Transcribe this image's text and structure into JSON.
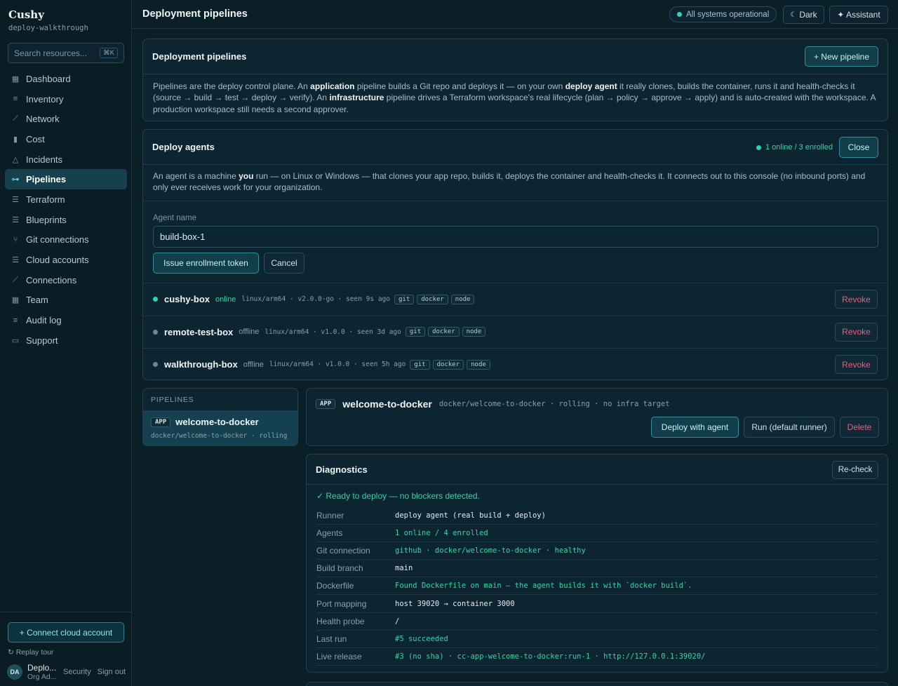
{
  "brand": {
    "name": "Cushy",
    "workspace": "deploy-walkthrough"
  },
  "search": {
    "placeholder": "Search resources...",
    "shortcut": "⌘K"
  },
  "nav": [
    {
      "label": "Dashboard",
      "icon": "grid-icon"
    },
    {
      "label": "Inventory",
      "icon": "list-icon"
    },
    {
      "label": "Network",
      "icon": "network-icon"
    },
    {
      "label": "Cost",
      "icon": "bar-chart-icon"
    },
    {
      "label": "Incidents",
      "icon": "warning-icon"
    },
    {
      "label": "Pipelines",
      "icon": "pipeline-icon",
      "active": true
    },
    {
      "label": "Terraform",
      "icon": "stack-icon"
    },
    {
      "label": "Blueprints",
      "icon": "stack-icon"
    },
    {
      "label": "Git connections",
      "icon": "git-branch-icon"
    },
    {
      "label": "Cloud accounts",
      "icon": "stack-icon"
    },
    {
      "label": "Connections",
      "icon": "link-icon"
    },
    {
      "label": "Team",
      "icon": "grid-icon"
    },
    {
      "label": "Audit log",
      "icon": "list-icon"
    },
    {
      "label": "Support",
      "icon": "chat-icon"
    }
  ],
  "sidebar_bottom": {
    "connect_label": "+ Connect cloud account",
    "replay_label": "Replay tour",
    "avatar_initials": "DA",
    "user_name": "Deplo...",
    "user_role": "Org Ad...",
    "security_label": "Security",
    "signout_label": "Sign out"
  },
  "topbar": {
    "title": "Deployment pipelines",
    "status": "All systems operational",
    "theme_label": "Dark",
    "assistant_label": "✦ Assistant"
  },
  "intro": {
    "title": "Deployment pipelines",
    "new_label": "+ New pipeline",
    "p_a": "Pipelines are the deploy control plane. An ",
    "p_b": "application",
    "p_c": " pipeline builds a Git repo and deploys it — on your own ",
    "p_d": "deploy agent",
    "p_e": " it really clones, builds the container, runs it and health-checks it (source → build → test → deploy → verify). An ",
    "p_f": "infrastructure",
    "p_g": " pipeline drives a Terraform workspace's real lifecycle (plan → policy → approve → apply) and is auto-created with the workspace. A production workspace still needs a second approver."
  },
  "agents": {
    "title": "Deploy agents",
    "summary": "1 online / 3 enrolled",
    "close_label": "Close",
    "p_a": "An agent is a machine ",
    "p_b": "you",
    "p_c": " run — on Linux or Windows — that clones your app repo, builds it, deploys the container and health-checks it. It connects out to this console (no inbound ports) and only ever receives work for your organization.",
    "name_label": "Agent name",
    "name_value": "build-box-1",
    "issue_label": "Issue enrollment token",
    "cancel_label": "Cancel",
    "revoke_label": "Revoke",
    "list": [
      {
        "name": "cushy-box",
        "status": "online",
        "meta": "linux/arm64 · v2.0.0-go · seen 9s ago",
        "tags": [
          "git",
          "docker",
          "node"
        ],
        "color": "#2ed5a8"
      },
      {
        "name": "remote-test-box",
        "status": "offline",
        "meta": "linux/arm64 · v1.0.0 · seen 3d ago",
        "tags": [
          "git",
          "docker",
          "node"
        ],
        "color": "#6f8790"
      },
      {
        "name": "walkthrough-box",
        "status": "offline",
        "meta": "linux/arm64 · v1.0.0 · seen 5h ago",
        "tags": [
          "git",
          "docker",
          "node"
        ],
        "color": "#6f8790"
      }
    ]
  },
  "pipelines_panel": {
    "heading": "PIPELINES",
    "item_badge": "APP",
    "item_name": "welcome-to-docker",
    "item_meta": "docker/welcome-to-docker · rolling"
  },
  "detail": {
    "badge": "APP",
    "name": "welcome-to-docker",
    "meta": "docker/welcome-to-docker · rolling · no infra target",
    "deploy_label": "Deploy with agent",
    "run_label": "Run (default runner)",
    "delete_label": "Delete"
  },
  "diagnostics": {
    "title": "Diagnostics",
    "recheck_label": "Re-check",
    "ready": "✓ Ready to deploy — no blockers detected.",
    "rows": [
      {
        "k": "Runner",
        "v": "deploy agent (real build + deploy)",
        "ok": false
      },
      {
        "k": "Agents",
        "v": "1 online / 4 enrolled",
        "ok": true
      },
      {
        "k": "Git connection",
        "v": "github · docker/welcome-to-docker · healthy",
        "ok": true
      },
      {
        "k": "Build branch",
        "v": "main",
        "ok": false
      },
      {
        "k": "Dockerfile",
        "v": "Found Dockerfile on main — the agent builds it with `docker build`.",
        "ok": true
      },
      {
        "k": "Port mapping",
        "v": "host 39020 → container 3000",
        "ok": false
      },
      {
        "k": "Health probe",
        "v": "/",
        "ok": false
      },
      {
        "k": "Last run",
        "v": "#5 succeeded",
        "ok": true
      },
      {
        "k": "Live release",
        "v": "#3 (no sha) · cc-app-welcome-to-docker:run-1 · http://127.0.0.1:39020/",
        "ok": true
      }
    ]
  },
  "colors": {
    "accent": "#2ed5a8",
    "danger": "#ef5c7d",
    "background": "#0b1f28"
  }
}
